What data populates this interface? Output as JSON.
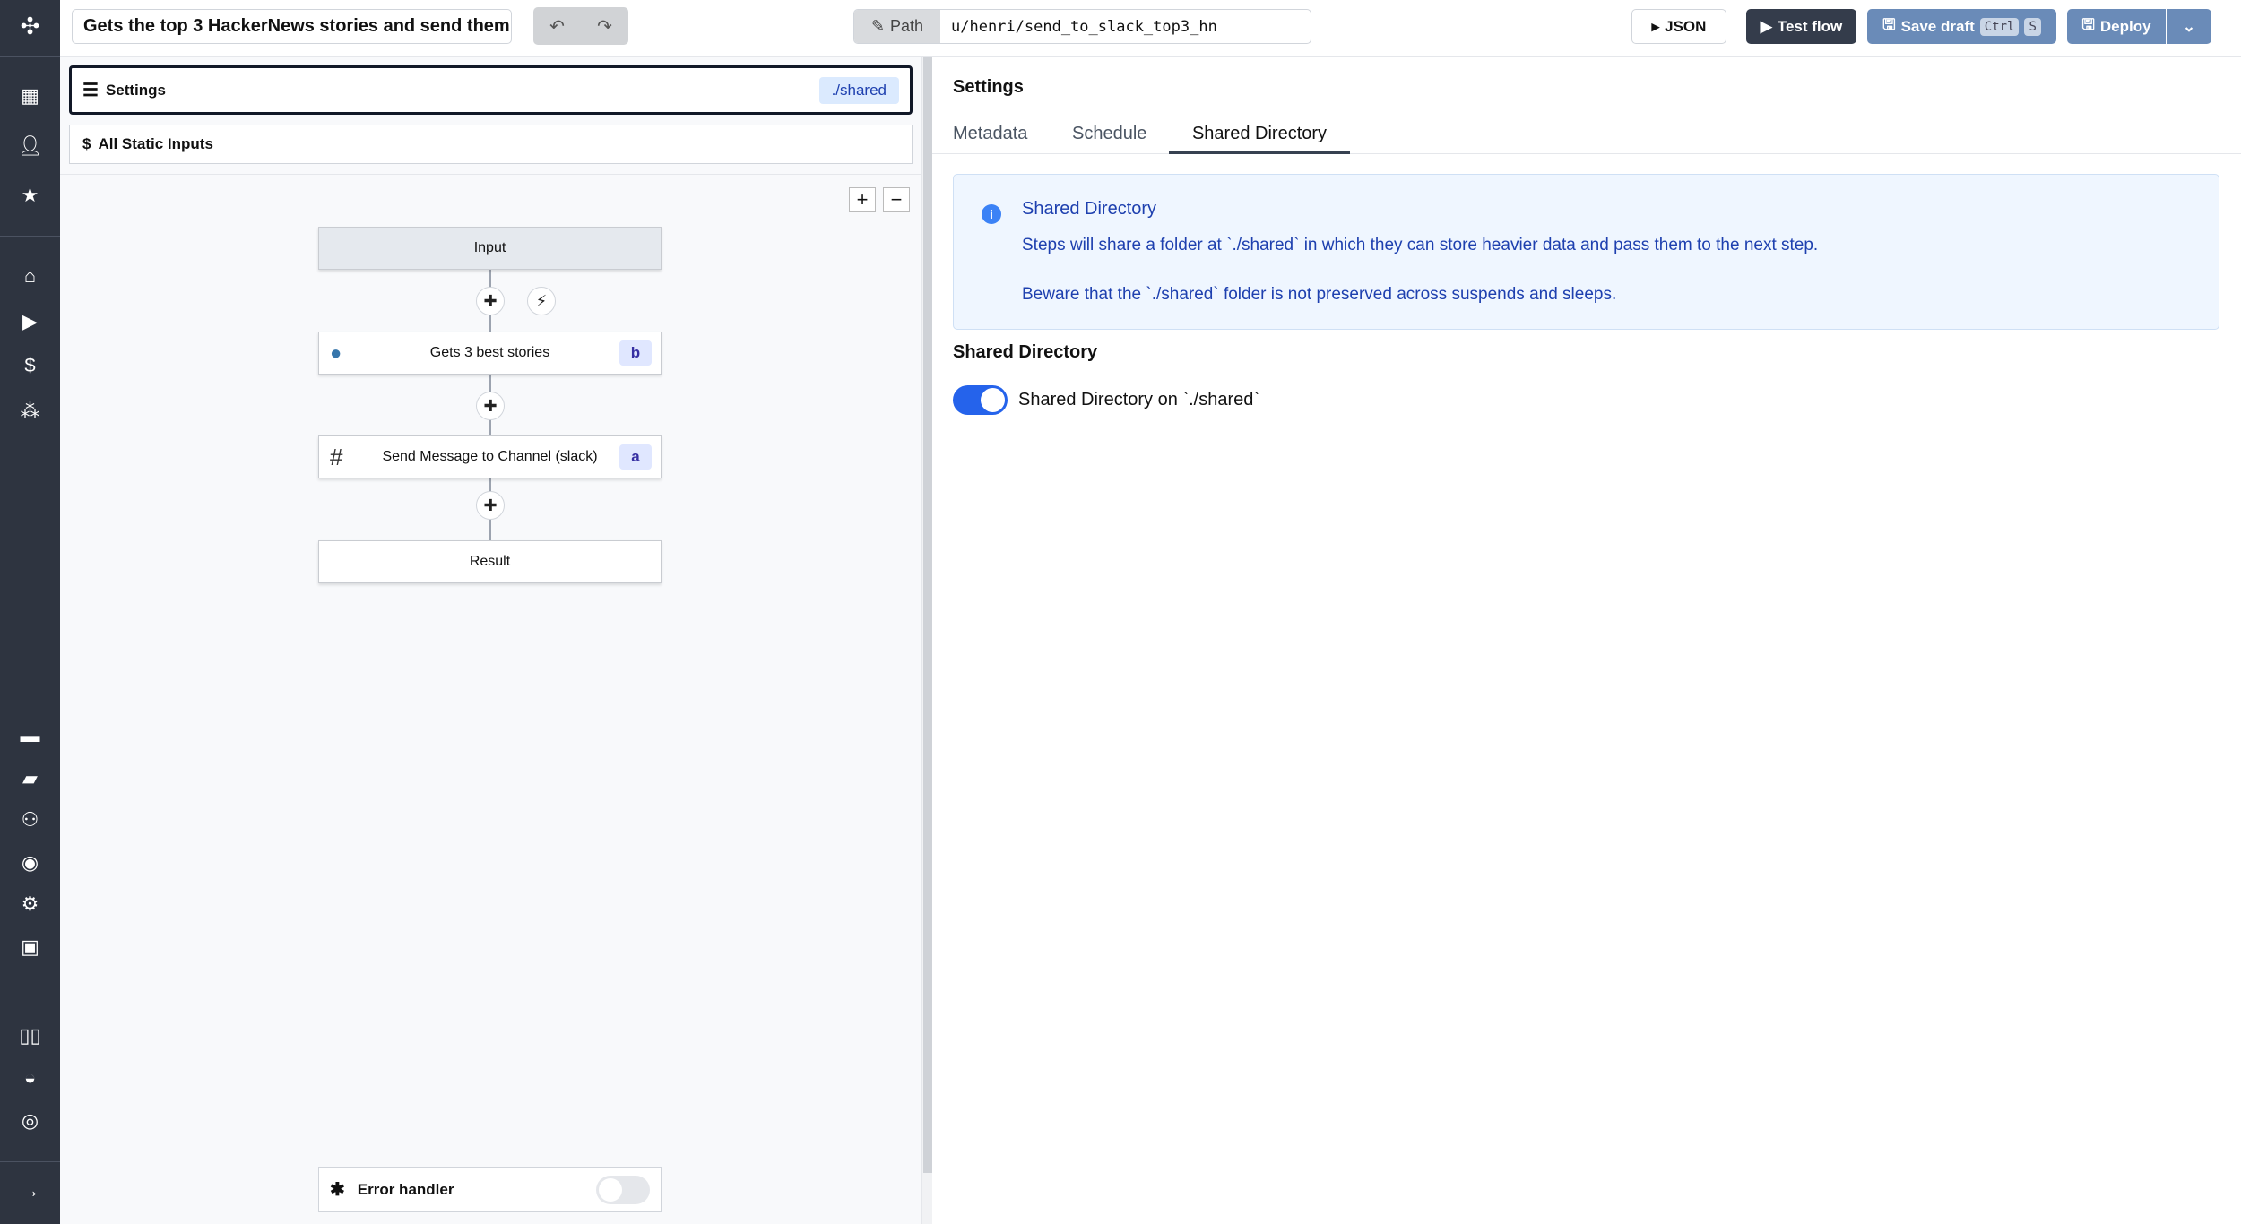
{
  "sidebar": {
    "icons": [
      "windmill-logo-icon",
      "scripts-icon",
      "user-icon",
      "star-icon",
      "home-icon",
      "runs-icon",
      "dollar-icon",
      "resources-icon",
      "schedule-icon",
      "folder-icon",
      "groups-icon",
      "audit-eye-icon",
      "settings-gear-icon",
      "bot-icon",
      "docs-book-icon",
      "discord-icon",
      "github-icon",
      "expand-arrow-icon"
    ]
  },
  "topbar": {
    "title": "Gets the top 3 HackerNews stories and send them",
    "path_label": "Path",
    "path_value": "u/henri/send_to_slack_top3_hn",
    "json_label": "JSON",
    "test_flow_label": "Test flow",
    "save_draft_label": "Save draft",
    "kbd_ctrl": "Ctrl",
    "kbd_s": "S",
    "deploy_label": "Deploy"
  },
  "left": {
    "settings_label": "Settings",
    "shared_badge": "./shared",
    "static_inputs_label": "All Static Inputs",
    "nodes": [
      {
        "label": "Input"
      },
      {
        "label": "Gets 3 best stories",
        "badge": "b",
        "icon": "python-icon"
      },
      {
        "label": "Send Message to Channel (slack)",
        "badge": "a",
        "icon": "slack-icon"
      },
      {
        "label": "Result"
      }
    ],
    "error_handler_label": "Error handler",
    "error_handler_enabled": false
  },
  "right": {
    "title": "Settings",
    "tabs": [
      "Metadata",
      "Schedule",
      "Shared Directory"
    ],
    "active_tab": "Shared Directory",
    "info": {
      "title": "Shared Directory",
      "line1": "Steps will share a folder at `./shared` in which they can store heavier data and pass them to the next step.",
      "line2": "Beware that the `./shared` folder is not preserved across suspends and sleeps."
    },
    "section_title": "Shared Directory",
    "toggle_label": "Shared Directory on `./shared`",
    "toggle_enabled": true
  },
  "colors": {
    "sidebar": "#2e3440",
    "accent": "#2563eb",
    "save_btn": "#6a8bb8",
    "info_bg": "#eff6ff",
    "info_text": "#1e40af"
  }
}
